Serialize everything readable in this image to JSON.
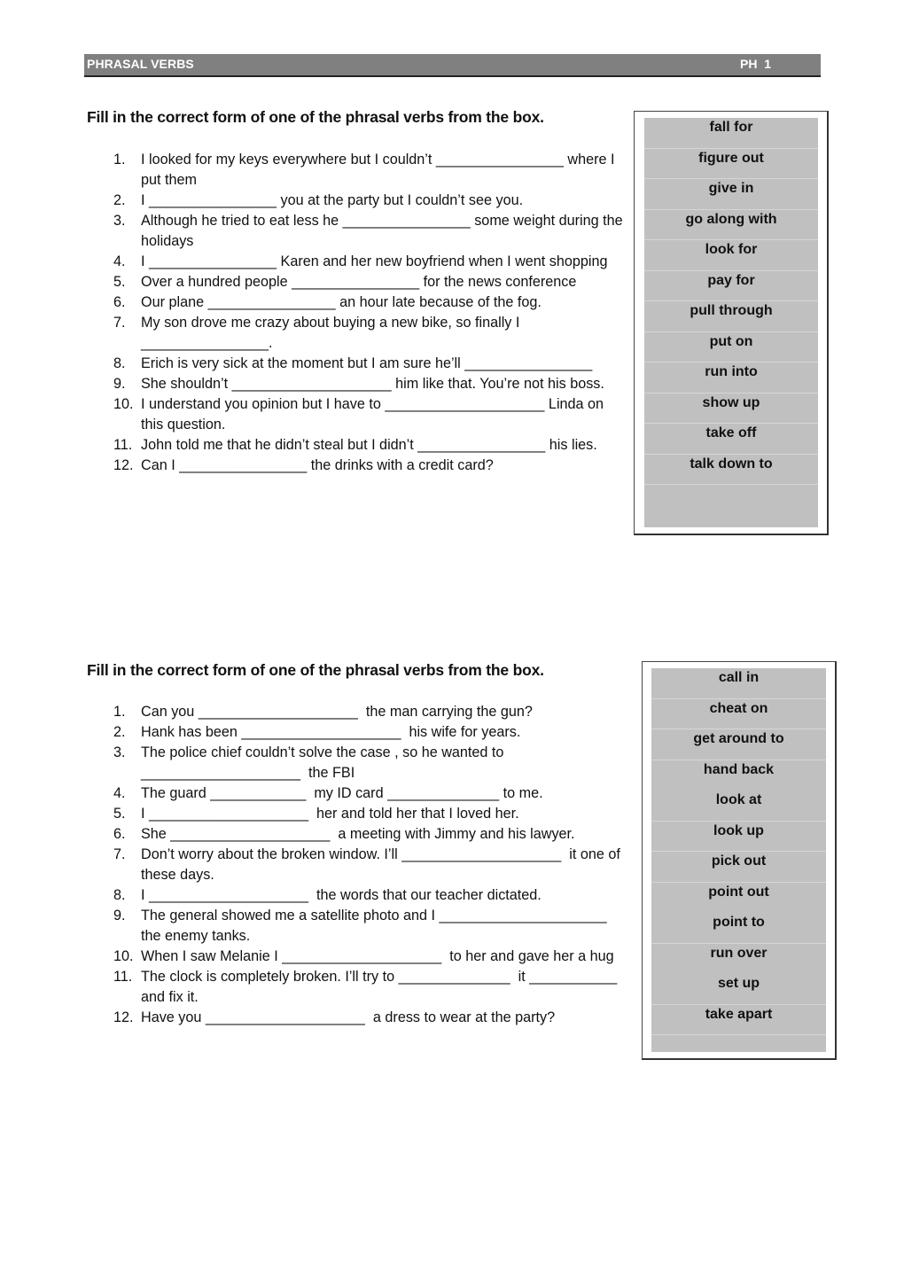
{
  "header": {
    "title": "PHRASAL VERBS",
    "code": "PH  1"
  },
  "exercises": [
    {
      "instruction": "Fill in the correct form of one of the phrasal verbs from the box.",
      "questions": [
        {
          "num": "1.",
          "text": "I looked for my keys everywhere but I couldn’t ________________ where I put them"
        },
        {
          "num": "2.",
          "text": "I ________________ you at the party but I couldn’t see you."
        },
        {
          "num": "3.",
          "text": "Although he tried to eat less he ________________ some weight during the holidays"
        },
        {
          "num": "4.",
          "text": "I ________________ Karen and her new boyfriend when I went shopping"
        },
        {
          "num": "5.",
          "text": "Over a hundred people ________________ for the news conference"
        },
        {
          "num": "6.",
          "text": "Our plane ________________ an hour late because of the fog."
        },
        {
          "num": "7.",
          "text": "My son drove me crazy about buying a new bike, so finally I ________________."
        },
        {
          "num": "8.",
          "text": "Erich is very sick at the moment but I am sure he’ll ________________"
        },
        {
          "num": "9.",
          "text": "She shouldn’t ____________________ him like that. You’re not his boss."
        },
        {
          "num": "10.",
          "text": "I understand you opinion but I have to ____________________ Linda on this question."
        },
        {
          "num": "11.",
          "text": "John told me that he didn’t steal but I didn’t ________________ his lies."
        },
        {
          "num": "12.",
          "text": "Can I ________________ the drinks with a credit card?"
        }
      ],
      "verbs": [
        "fall for",
        "figure out",
        "give in",
        "go along with",
        "look for",
        "pay for",
        "pull through",
        "put on",
        "run into",
        "show up",
        "take off",
        "talk down to"
      ]
    },
    {
      "instruction": "Fill in the correct form of one of the phrasal verbs from the box.",
      "questions": [
        {
          "num": "1.",
          "text": "Can you ____________________  the man carrying the gun?"
        },
        {
          "num": "2.",
          "text": "Hank has been ____________________  his wife for years."
        },
        {
          "num": "3.",
          "text": "The police chief couldn’t solve the case , so he wanted to ____________________  the FBI"
        },
        {
          "num": "4.",
          "text": "The guard ____________  my ID card ______________ to me."
        },
        {
          "num": "5.",
          "text": "I ____________________  her and told her that I loved her."
        },
        {
          "num": "6.",
          "text": "She ____________________  a meeting with Jimmy and his lawyer."
        },
        {
          "num": "7.",
          "text": "Don’t worry about the broken window. I’ll ____________________  it one of these days."
        },
        {
          "num": "8.",
          "text": "I ____________________  the words that our teacher dictated."
        },
        {
          "num": "9.",
          "text": "The general showed me a satellite photo and I _____________________ the enemy tanks."
        },
        {
          "num": "10.",
          "text": "When I saw Melanie I ____________________  to her and gave her a hug"
        },
        {
          "num": "11.",
          "text": "The clock is completely broken. I’ll try to ______________  it ___________ and fix it."
        },
        {
          "num": "12.",
          "text": "Have you ____________________  a dress to wear at the party?"
        }
      ],
      "verbs": [
        "call in",
        "cheat on",
        "get around to",
        "hand back",
        "look at",
        "look up",
        "pick out",
        "point out",
        "point to",
        "run over",
        "set up",
        "take apart"
      ]
    }
  ]
}
